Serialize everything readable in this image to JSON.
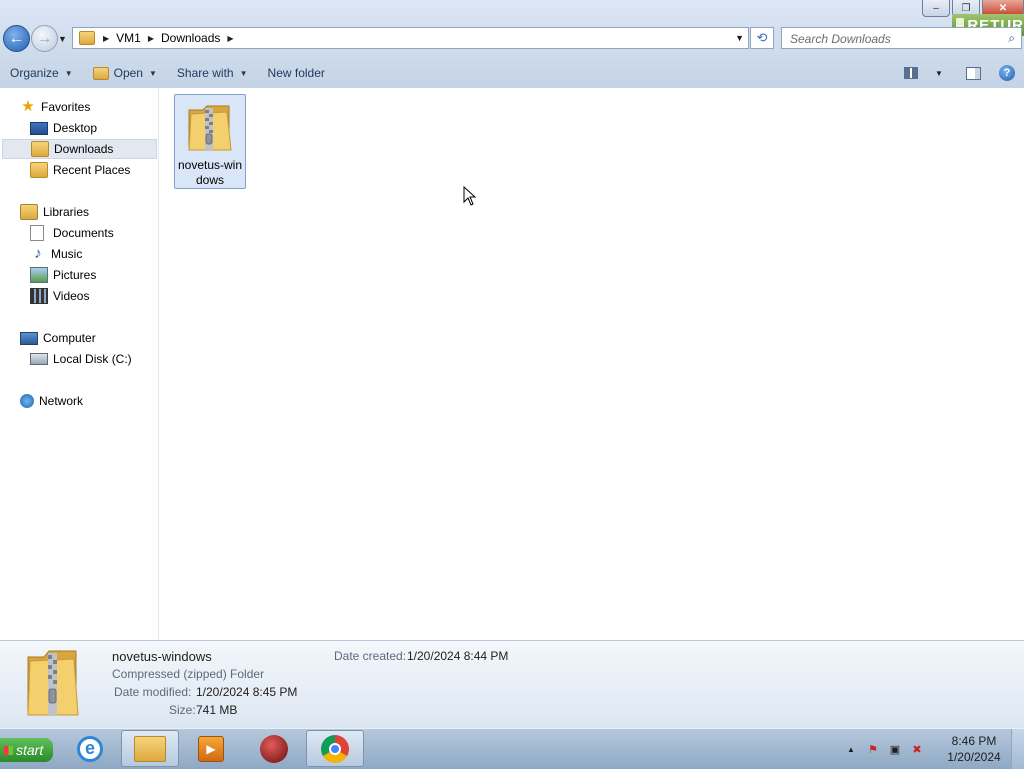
{
  "window": {
    "controls": {
      "minimize": "‒",
      "maximize": "❐",
      "close": "✕"
    },
    "badge": "RETUR"
  },
  "nav_buttons": {
    "back": "←",
    "forward": "→",
    "recent": "▼"
  },
  "address": {
    "crumbs": [
      "VM1",
      "Downloads"
    ],
    "separator": "▶",
    "dropdown": "▼",
    "refresh": "⟲"
  },
  "search": {
    "placeholder": "Search Downloads",
    "icon": "⌕"
  },
  "toolbar": {
    "organize": "Organize",
    "open": "Open",
    "share_with": "Share with",
    "new_folder": "New folder",
    "caret": "▼",
    "help": "?"
  },
  "nav": {
    "favorites": {
      "label": "Favorites",
      "items": [
        "Desktop",
        "Downloads",
        "Recent Places"
      ],
      "selected": "Downloads"
    },
    "libraries": {
      "label": "Libraries",
      "items": [
        "Documents",
        "Music",
        "Pictures",
        "Videos"
      ]
    },
    "computer": {
      "label": "Computer",
      "items": [
        "Local Disk (C:)"
      ]
    },
    "network": {
      "label": "Network"
    }
  },
  "files": [
    {
      "name": "novetus-windows",
      "type": "zip-folder",
      "selected": true
    }
  ],
  "details": {
    "name": "novetus-windows",
    "type": "Compressed (zipped) Folder",
    "date_modified_label": "Date modified:",
    "date_modified": "1/20/2024 8:45 PM",
    "size_label": "Size:",
    "size": "741 MB",
    "date_created_label": "Date created:",
    "date_created": "1/20/2024 8:44 PM"
  },
  "taskbar": {
    "start_label": "start",
    "apps": [
      "internet-explorer-icon",
      "windows-explorer-icon",
      "media-player-icon",
      "red-app-icon",
      "chrome-icon"
    ],
    "active_apps": [
      "windows-explorer-icon",
      "chrome-icon"
    ],
    "tray_arrow": "▲",
    "time": "8:46 PM",
    "date": "1/20/2024"
  },
  "colors": {
    "chrome_bg": "#cfdcec",
    "selection": "#d8e6f7",
    "toolbar_text": "#1e395b",
    "taskbar": "#a3b9d3"
  }
}
